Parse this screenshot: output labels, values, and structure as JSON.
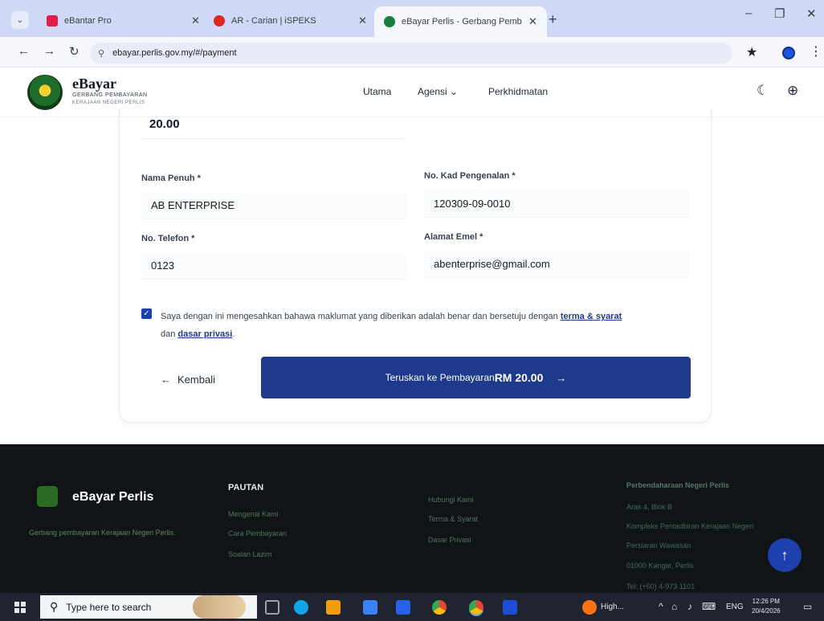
{
  "browser": {
    "tabs": [
      {
        "title": "eBantar Pro",
        "active": false,
        "color": "#e11d48"
      },
      {
        "title": "AR - Carian | iSPEKS",
        "active": false,
        "color": "#dc2626"
      },
      {
        "title": "eBayar Perlis - Gerbang Pemba",
        "active": true,
        "color": "#15803d"
      }
    ],
    "url": "ebayar.perlis.gov.my/#/payment"
  },
  "header": {
    "brand_name": "eBayar",
    "brand_sub1": "GERBANG PEMBAYARAN",
    "brand_sub2": "KERAJAAN NEGERI PERLIS",
    "nav": {
      "home": "Utama",
      "agency": "Agensi",
      "services": "Perkhidmatan"
    }
  },
  "form": {
    "amount_top": "20.00",
    "full_name_label": "Nama Penuh *",
    "full_name_value": "AB ENTERPRISE",
    "ic_label": "No. Kad Pengenalan *",
    "ic_value": "120309-09-0010",
    "phone_label": "No. Telefon *",
    "phone_value": "0123",
    "email_label": "Alamat Emel *",
    "email_value": "abenterprise@gmail.com",
    "consent_prefix": "Saya dengan ini mengesahkan bahawa maklumat yang diberikan adalah benar dan bersetuju dengan",
    "consent_terms": "terma & syarat",
    "consent_mid": "dan",
    "consent_privacy": "dasar privasi",
    "consent_suffix": ".",
    "checked": true,
    "back_label": "Kembali",
    "pay_label": "Teruskan ke Pembayaran",
    "pay_amount": "RM 20.00"
  },
  "footer": {
    "brand": "eBayar Perlis",
    "desc": "Gerbang pembayaran Kerajaan Negeri Perlis.",
    "links_heading": "PAUTAN",
    "links": [
      "Mengenai Kami",
      "Cara Pembayaran",
      "Soalan Lazim"
    ],
    "links2": [
      "Hubungi Kami",
      "Terma & Syarat",
      "Dasar Privasi"
    ],
    "address_heading": "Perbendaharaan Negeri Perlis",
    "address_lines": [
      "Aras 4, Blok B",
      "Kompleks Pentadbiran Kerajaan Negeri",
      "Persiaran Wawasan",
      "01000 Kangar, Perlis",
      "Tel: (+60) 4-973 1101"
    ]
  },
  "taskbar": {
    "search_placeholder": "Type here to search",
    "weather_text": "High...",
    "lang": "ENG",
    "time": "12:26 PM",
    "date": "20/4/2026"
  }
}
